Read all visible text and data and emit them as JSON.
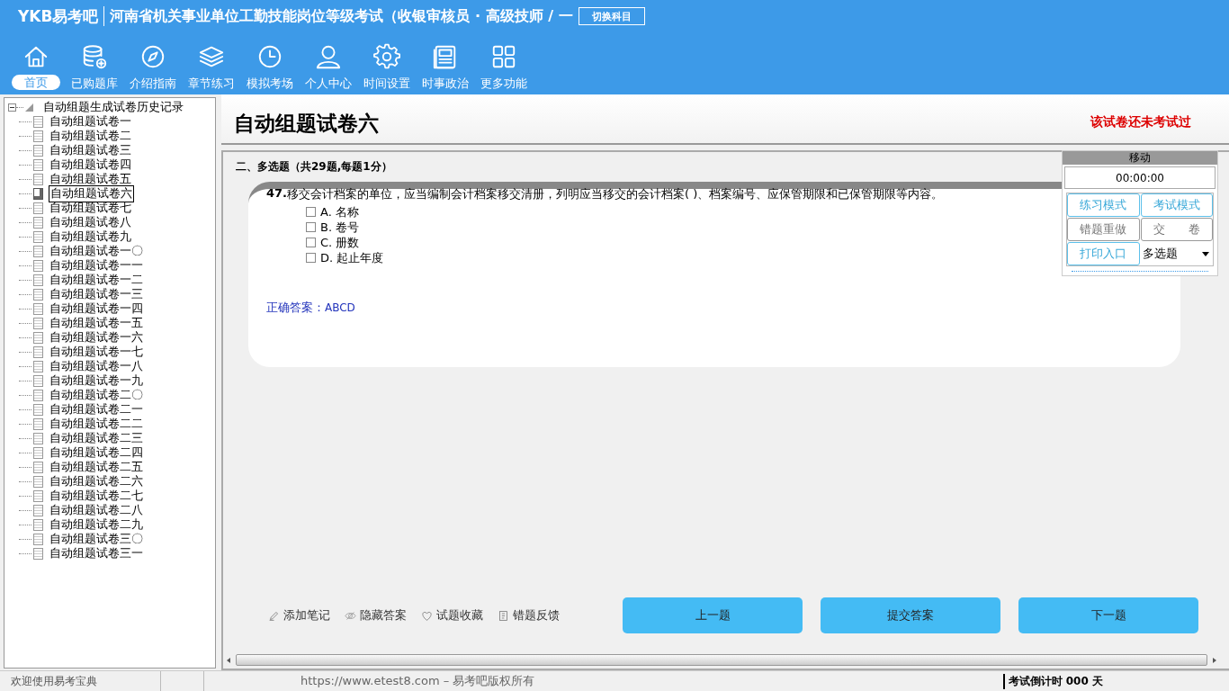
{
  "header": {
    "logo": "YKB易考吧",
    "title": "河南省机关事业单位工勤技能岗位等级考试（收银审核员 · 高级技师 / 一",
    "switch_button": "切换科目"
  },
  "nav": [
    {
      "label": "首页",
      "selected": true
    },
    {
      "label": "已购题库",
      "selected": false
    },
    {
      "label": "介绍指南",
      "selected": false
    },
    {
      "label": "章节练习",
      "selected": false
    },
    {
      "label": "模拟考场",
      "selected": false
    },
    {
      "label": "个人中心",
      "selected": false
    },
    {
      "label": "时间设置",
      "selected": false
    },
    {
      "label": "时事政治",
      "selected": false
    },
    {
      "label": "更多功能",
      "selected": false
    }
  ],
  "tree": {
    "label": "自动组题生成试卷历史记录",
    "expanded": true,
    "children": [
      {
        "label": "自动组题试卷一",
        "selected": false
      },
      {
        "label": "自动组题试卷二",
        "selected": false
      },
      {
        "label": "自动组题试卷三",
        "selected": false
      },
      {
        "label": "自动组题试卷四",
        "selected": false
      },
      {
        "label": "自动组题试卷五",
        "selected": false
      },
      {
        "label": "自动组题试卷六",
        "selected": true
      },
      {
        "label": "自动组题试卷七",
        "selected": false
      },
      {
        "label": "自动组题试卷八",
        "selected": false
      },
      {
        "label": "自动组题试卷九",
        "selected": false
      },
      {
        "label": "自动组题试卷一〇",
        "selected": false
      },
      {
        "label": "自动组题试卷一一",
        "selected": false
      },
      {
        "label": "自动组题试卷一二",
        "selected": false
      },
      {
        "label": "自动组题试卷一三",
        "selected": false
      },
      {
        "label": "自动组题试卷一四",
        "selected": false
      },
      {
        "label": "自动组题试卷一五",
        "selected": false
      },
      {
        "label": "自动组题试卷一六",
        "selected": false
      },
      {
        "label": "自动组题试卷一七",
        "selected": false
      },
      {
        "label": "自动组题试卷一八",
        "selected": false
      },
      {
        "label": "自动组题试卷一九",
        "selected": false
      },
      {
        "label": "自动组题试卷二〇",
        "selected": false
      },
      {
        "label": "自动组题试卷二一",
        "selected": false
      },
      {
        "label": "自动组题试卷二二",
        "selected": false
      },
      {
        "label": "自动组题试卷二三",
        "selected": false
      },
      {
        "label": "自动组题试卷二四",
        "selected": false
      },
      {
        "label": "自动组题试卷二五",
        "selected": false
      },
      {
        "label": "自动组题试卷二六",
        "selected": false
      },
      {
        "label": "自动组题试卷二七",
        "selected": false
      },
      {
        "label": "自动组题试卷二八",
        "selected": false
      },
      {
        "label": "自动组题试卷二九",
        "selected": false
      },
      {
        "label": "自动组题试卷三〇",
        "selected": false
      },
      {
        "label": "自动组题试卷三一",
        "selected": false
      }
    ]
  },
  "paper": {
    "title": "自动组题试卷六",
    "status": "该试卷还未考试过"
  },
  "section": "二、多选题（共29题,每题1分）",
  "question": {
    "number": "47.",
    "text": "移交会计档案的单位，应当编制会计档案移交清册，列明应当移交的会计档案( )、档案编号、应保管期限和已保管期限等内容。",
    "options": [
      {
        "label": "A. 名称",
        "checked": false
      },
      {
        "label": "B. 卷号",
        "checked": false
      },
      {
        "label": "C. 册数",
        "checked": false
      },
      {
        "label": "D. 起止年度",
        "checked": false
      }
    ],
    "answer_label": "正确答案：",
    "answer": "ABCD"
  },
  "panel": {
    "header": "移动",
    "timer": "00:00:00",
    "buttons": [
      {
        "label": "练习模式",
        "disabled": false
      },
      {
        "label": "考试模式",
        "disabled": false
      },
      {
        "label": "错题重做",
        "disabled": true
      },
      {
        "label": "交　　卷",
        "disabled": true
      },
      {
        "label": "打印入口",
        "disabled": false
      }
    ],
    "select": "多选题"
  },
  "tools": [
    "添加笔记",
    "隐藏答案",
    "试题收藏",
    "错题反馈"
  ],
  "buttons": [
    "上一题",
    "提交答案",
    "下一题"
  ],
  "status_bar": {
    "welcome": "欢迎使用易考宝典",
    "copyright": "https://www.etest8.com – 易考吧版权所有",
    "countdown": "考试倒计时 000 天"
  }
}
